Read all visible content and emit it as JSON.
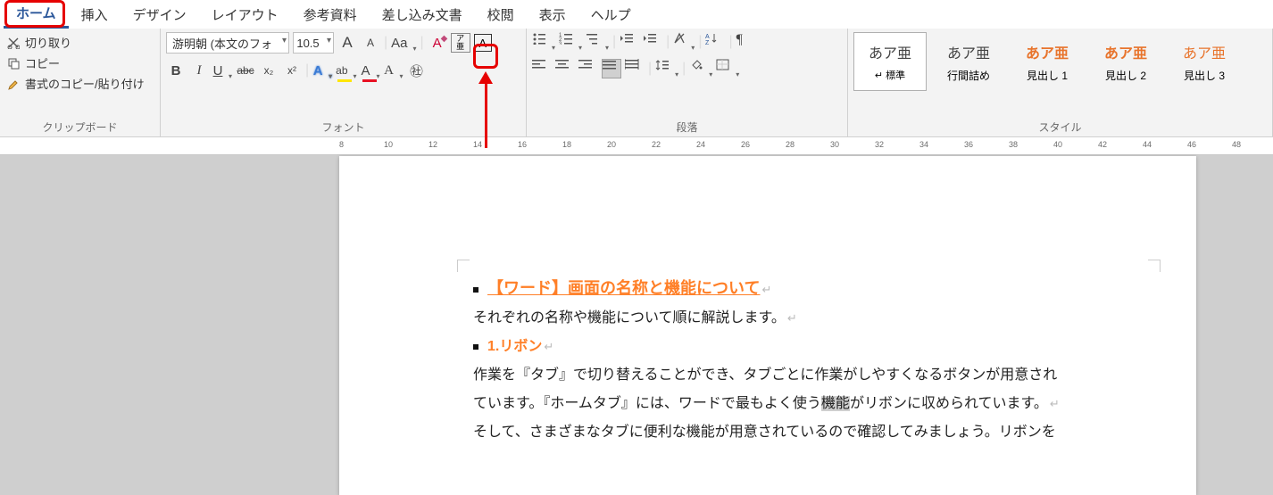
{
  "tabs": [
    "ホーム",
    "挿入",
    "デザイン",
    "レイアウト",
    "参考資料",
    "差し込み文書",
    "校閲",
    "表示",
    "ヘルプ"
  ],
  "clipboard": {
    "cut": "切り取り",
    "copy": "コピー",
    "paste": "書式のコピー/貼り付け",
    "group": "クリップボード"
  },
  "font": {
    "name": "游明朝 (本文のフォ",
    "size": "10.5",
    "inc": "A",
    "dec": "A",
    "case": "Aa",
    "clear": "A",
    "ruby": "ア\n亜",
    "border": "A",
    "bold": "B",
    "italic": "I",
    "underline": "U",
    "strike": "abc",
    "sub": "x₂",
    "sup": "x²",
    "effects": "A",
    "highlight": "ab",
    "color": "A",
    "ruby2": "A",
    "circled": "㊓",
    "group": "フォント"
  },
  "paragraph": {
    "group": "段落"
  },
  "styles": {
    "group": "スタイル",
    "items": [
      {
        "preview": "あア亜",
        "name": "標準",
        "sel": true,
        "color": "#444"
      },
      {
        "preview": "あア亜",
        "name": "行間詰め",
        "color": "#444"
      },
      {
        "preview": "あア亜",
        "name": "見出し 1",
        "color": "#e8742c"
      },
      {
        "preview": "あア亜",
        "name": "見出し 2",
        "color": "#e8742c"
      },
      {
        "preview": "あア亜",
        "name": "見出し 3",
        "color": "#e8742c"
      }
    ]
  },
  "ruler_marks": [
    8,
    10,
    12,
    14,
    16,
    18,
    20,
    22,
    24,
    26,
    28,
    30,
    32,
    34,
    36,
    38,
    40,
    42,
    44,
    46,
    48
  ],
  "annotation": "ルビボタン",
  "doc": {
    "title": "【ワード】画面の名称と機能について",
    "p1": "それぞれの名称や機能について順に解説します。",
    "sub": "1.リボン",
    "p2a": "作業を『タブ』で切り替えることができ、タブごとに作業がしやすくなるボタンが用意され",
    "p2b_pre": "ています。『ホームタブ』には、ワードで最もよく使う",
    "p2b_hl": "機能",
    "p2b_post": "がリボンに収められています。",
    "p3": "そして、さまざまなタブに便利な機能が用意されているので確認してみましょう。リボンを"
  }
}
